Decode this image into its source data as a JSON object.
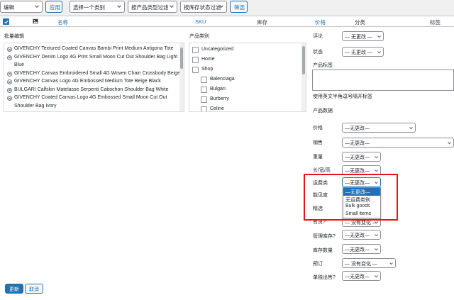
{
  "filters": {
    "bulk_action": "编辑",
    "apply": "应用",
    "category": "选择一个类别",
    "product_type": "按产品类型过滤",
    "stock_status": "按库存状态过滤",
    "filter": "筛选"
  },
  "columns": {
    "name": "名称",
    "sku": "SKU",
    "stock": "库存",
    "price": "价格",
    "categories": "分类",
    "tags": "标签"
  },
  "bulk_edit": {
    "title": "批量编辑",
    "products": [
      "GIVENCHY Textured Coated Canvas Bambi Print Medium Antigona Tote",
      "GIVENCHY Denim Logo 4G Print Small Moon Cut Out Shoulder Bag Light",
      "Blue",
      "GIVENCHY Canvas Embroidered Small 4G Woven Chain Crossbody Beige",
      "GIVENCHY Canvas Logo 4G Embossed Medium Tote Beige Black",
      "BULGARI Calfskin Matelasse Serpenti Cabochon Shoulder Bag White",
      "GIVENCHY Coated Canvas Logo 4G Embossed Small Moon Cut Out",
      "Shoulder Bag Ivory"
    ]
  },
  "categories_box": {
    "title": "产品类别",
    "items": [
      "Uncategorized",
      "Home",
      "Shop",
      "Balenciaga",
      "Bulgari",
      "Burberry",
      "Celine"
    ]
  },
  "right": {
    "comment_label": "评论",
    "status_label": "状态",
    "no_change": "— 无更改 —",
    "no_change_short": "—无更改—",
    "no_change_alt": "— 没有变化 —",
    "tags_label": "产品标签",
    "tags_hint": "使用英文半角逗号隔开标签",
    "product_data": "产品数据",
    "price_label": "价格",
    "sale_label": "销售",
    "weight_label": "重量",
    "dims_label": "长/宽/高",
    "shipping_label": "运费类",
    "visibility_label": "能见度",
    "featured_label": "精选",
    "instock_label": "有货?",
    "manage_stock_label": "管理库存?",
    "stock_qty_label": "库存数量",
    "backorders_label": "预订",
    "sold_individually_label": "单独出售?"
  },
  "shipping_dropdown": {
    "options": [
      "—无更改—",
      "无运费类别",
      "Bulk goods",
      "Small items"
    ],
    "highlighted": 0
  },
  "actions": {
    "update": "更新",
    "cancel": "取消"
  },
  "colors": {
    "accent": "#2271b1",
    "highlight_box": "#e4161b",
    "dropdown_highlight": "#1e72bd"
  }
}
